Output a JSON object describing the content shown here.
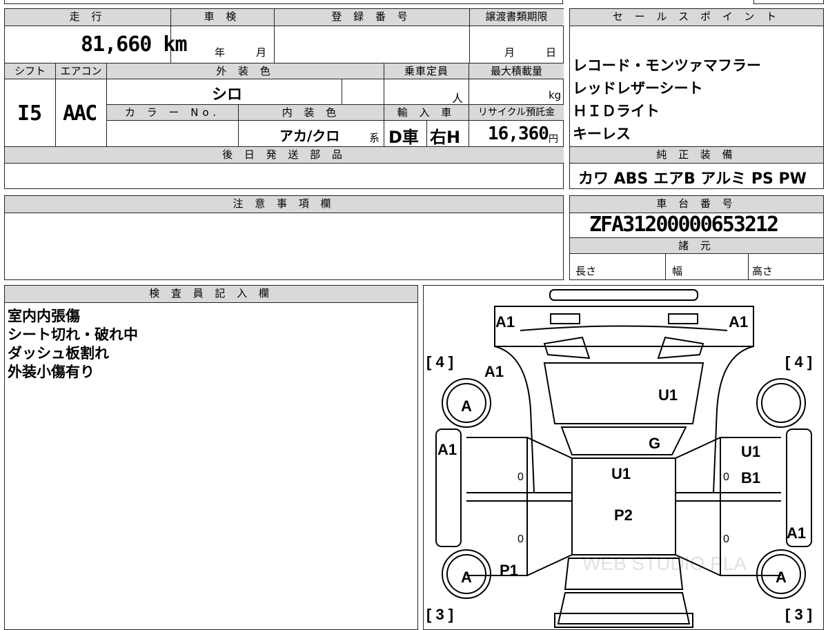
{
  "vehicle": {
    "headers": {
      "mileage": "走 行",
      "inspection": "車 検",
      "registration": "登 録 番 号",
      "transfer_deadline": "譲渡書類期限",
      "shift": "シフト",
      "aircon": "エアコン",
      "exterior_color": "外 装 色",
      "capacity": "乗車定員",
      "max_load": "最大積載量",
      "color_no": "カ ラ ー No.",
      "interior_color": "内 装 色",
      "import": "輸 入 車",
      "recycle": "リサイクル預託金",
      "later_parts": "後 日 発 送 部 品"
    },
    "mileage": "81,660 km",
    "inspection_year_unit": "年",
    "inspection_month_unit": "月",
    "deadline_month_unit": "月",
    "deadline_day_unit": "日",
    "shift": "I5",
    "aircon": "AAC",
    "exterior_color": "シロ",
    "capacity_unit": "人",
    "max_load_unit": "kg",
    "interior_color": "アカ/クロ",
    "interior_suffix": "系",
    "import_type": "D車",
    "steering": "右H",
    "recycle_fee": "16,360",
    "recycle_unit": "円"
  },
  "sales_points": {
    "header": "セ ー ル ス ポ イ ン ト",
    "items": [
      "レコード・モンツァマフラー",
      "レッドレザーシート",
      "ＨＩＤライト",
      "キーレス"
    ]
  },
  "equipment": {
    "header": "純 正 装 備",
    "text": "カワ ABS エアB アルミ PS PW"
  },
  "notes": {
    "header": "注 意 事 項 欄"
  },
  "chassis": {
    "header": "車 台 番 号",
    "number": "ZFA31200000653212"
  },
  "specs": {
    "header": "諸 元",
    "length": "長さ",
    "width": "幅",
    "height": "高さ"
  },
  "inspector": {
    "header": "検 査 員 記 入 欄",
    "lines": [
      "室内内張傷",
      "シート切れ・破れ中",
      "ダッシュ板割れ",
      "外装小傷有り"
    ]
  },
  "diagram": {
    "tire_front_left": "[ 4 ]",
    "tire_front_right": "[ 4 ]",
    "tire_rear_left": "[ 3 ]",
    "tire_rear_right": "[ 3 ]",
    "marks": [
      "A1",
      "A1",
      "A1",
      "U1",
      "A",
      "A1",
      "G",
      "U1",
      "U1",
      "B1",
      "P2",
      "A1",
      "P1",
      "A",
      "A"
    ],
    "zeros": [
      "0",
      "0",
      "0",
      "0"
    ],
    "watermark": "WEB STUDIO PLA"
  }
}
